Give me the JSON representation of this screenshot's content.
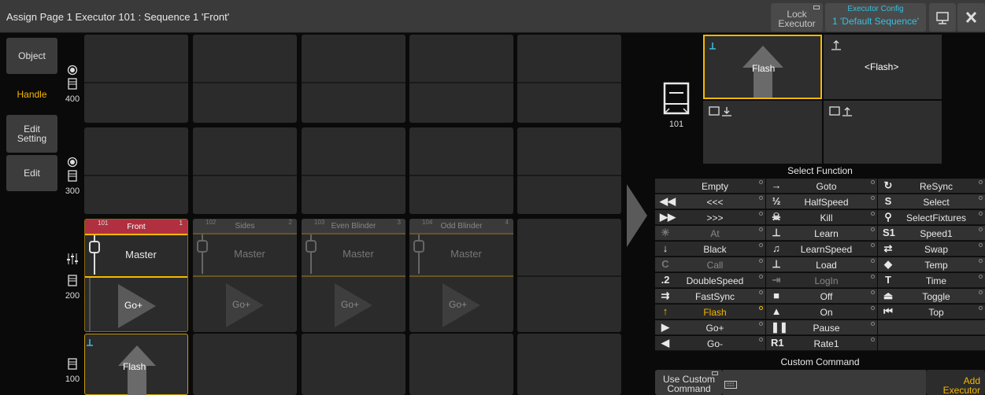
{
  "window": {
    "title": "Assign Page 1 Executor 101 : Sequence 1 'Front'",
    "lock_label": "Lock Executor",
    "config_label": "Executor Config",
    "config_value": "1 'Default Sequence'"
  },
  "tabs": [
    {
      "label": "Object"
    },
    {
      "label": "Handle"
    },
    {
      "label": "Edit Setting"
    },
    {
      "label": "Edit"
    }
  ],
  "rows": [
    {
      "number": "400"
    },
    {
      "number": "300"
    },
    {
      "number": "200"
    },
    {
      "number": "100"
    }
  ],
  "executors": [
    {
      "id": "101",
      "index": "1",
      "name": "Front",
      "master": "Master",
      "go": "Go+"
    },
    {
      "id": "102",
      "index": "2",
      "name": "Sides",
      "master": "Master",
      "go": "Go+"
    },
    {
      "id": "103",
      "index": "3",
      "name": "Even Blinder",
      "master": "Master",
      "go": "Go+"
    },
    {
      "id": "104",
      "index": "4",
      "name": "Odd Blinder",
      "master": "Master",
      "go": "Go+"
    }
  ],
  "flash_cell": {
    "label": "Flash"
  },
  "assignment": {
    "executor_number": "101",
    "key1": "Flash",
    "key2": "<Flash>"
  },
  "select_function": {
    "title": "Select Function",
    "col1": [
      {
        "icon": "",
        "label": "Empty"
      },
      {
        "icon": "◀◀",
        "label": "<<<"
      },
      {
        "icon": "▶▶",
        "label": ">>>"
      },
      {
        "icon": "☀",
        "label": "At"
      },
      {
        "icon": "↓",
        "label": "Black"
      },
      {
        "icon": "C",
        "label": "Call"
      },
      {
        "icon": ".2",
        "label": "DoubleSpeed"
      },
      {
        "icon": "⇉",
        "label": "FastSync"
      },
      {
        "icon": "↑",
        "label": "Flash"
      },
      {
        "icon": "▶",
        "label": "Go+"
      },
      {
        "icon": "◀",
        "label": "Go-"
      }
    ],
    "col2": [
      {
        "icon": "→",
        "label": "Goto"
      },
      {
        "icon": "½",
        "label": "HalfSpeed"
      },
      {
        "icon": "☠",
        "label": "Kill"
      },
      {
        "icon": "⊥",
        "label": "Learn"
      },
      {
        "icon": "♫",
        "label": "LearnSpeed"
      },
      {
        "icon": "⊥",
        "label": "Load"
      },
      {
        "icon": "⇥",
        "label": "LogIn"
      },
      {
        "icon": "■",
        "label": "Off"
      },
      {
        "icon": "▲",
        "label": "On"
      },
      {
        "icon": "❚❚",
        "label": "Pause"
      },
      {
        "icon": "R1",
        "label": "Rate1"
      }
    ],
    "col3": [
      {
        "icon": "↻",
        "label": "ReSync"
      },
      {
        "icon": "S",
        "label": "Select"
      },
      {
        "icon": "⚲",
        "label": "SelectFixtures"
      },
      {
        "icon": "S1",
        "label": "Speed1"
      },
      {
        "icon": "⇄",
        "label": "Swap"
      },
      {
        "icon": "◆",
        "label": "Temp"
      },
      {
        "icon": "T",
        "label": "Time"
      },
      {
        "icon": "⏏",
        "label": "Toggle"
      },
      {
        "icon": "⏮",
        "label": "Top"
      }
    ]
  },
  "custom_command": {
    "title": "Custom Command",
    "use_label": "Use Custom Command",
    "add_label": "Add Executor"
  },
  "colors": {
    "accent": "#f5b800",
    "cyan": "#36c0e0",
    "red_header": "#b03040"
  }
}
